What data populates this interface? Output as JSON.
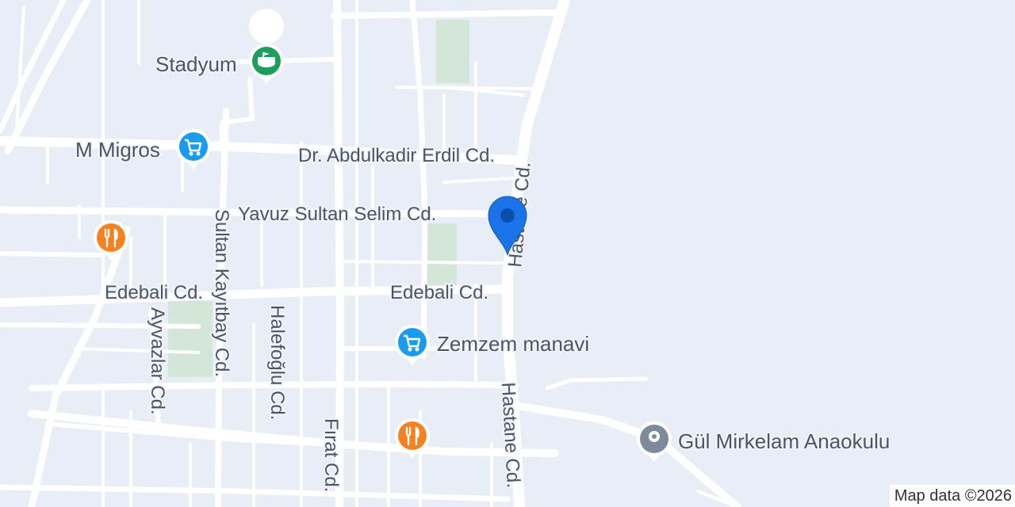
{
  "map": {
    "colors": {
      "land": "#e8edf6",
      "road": "#ffffff",
      "park": "#d4e6d8",
      "pin_blue": "#1a73e8",
      "pin_green": "#1e9e5c",
      "pin_shop": "#1a9bf0",
      "pin_food": "#f5821f",
      "pin_gray": "#7c8a99"
    },
    "roads": [
      {
        "name": "Dr. Abdulkadir Erdil Cd.",
        "label": "Dr. Abdulkadir Erdil Cd."
      },
      {
        "name": "Yavuz Sultan Selim Cd.",
        "label": "Yavuz Sultan Selim Cd."
      },
      {
        "name": "Edebali Cd.",
        "label": "Edebali Cd."
      },
      {
        "name": "Edebali Cd. (west)",
        "label": "Edebali Cd."
      },
      {
        "name": "Hastane Cd.",
        "label": "Hastane Cd."
      },
      {
        "name": "Hastane Cd. (south)",
        "label": "Hastane Cd."
      },
      {
        "name": "Sultan Kayıtbay Cd.",
        "label": "Sultan Kayıtbay Cd."
      },
      {
        "name": "Ayvazlar Cd.",
        "label": "Ayvazlar Cd."
      },
      {
        "name": "Halefoğlu Cd.",
        "label": "Halefoğlu Cd."
      },
      {
        "name": "Fırat Cd.",
        "label": "Fırat Cd."
      }
    ],
    "pois": [
      {
        "label": "Stadyum",
        "icon": "stadium-icon",
        "color": "#1e9e5c"
      },
      {
        "label": "M Migros",
        "icon": "shopping-cart-icon",
        "color": "#1a9bf0"
      },
      {
        "label": "Zemzem manavi",
        "icon": "shopping-cart-icon",
        "color": "#1a9bf0"
      },
      {
        "label": "Gül Mirkelam Anaokulu",
        "icon": "place-dot-icon",
        "color": "#7c8a99"
      },
      {
        "label": "",
        "icon": "restaurant-icon",
        "color": "#f5821f"
      },
      {
        "label": "",
        "icon": "restaurant-icon",
        "color": "#f5821f"
      }
    ],
    "location_marker": {
      "icon": "location-pin-icon",
      "color": "#1a73e8"
    },
    "attribution": "Map data ©2026"
  }
}
